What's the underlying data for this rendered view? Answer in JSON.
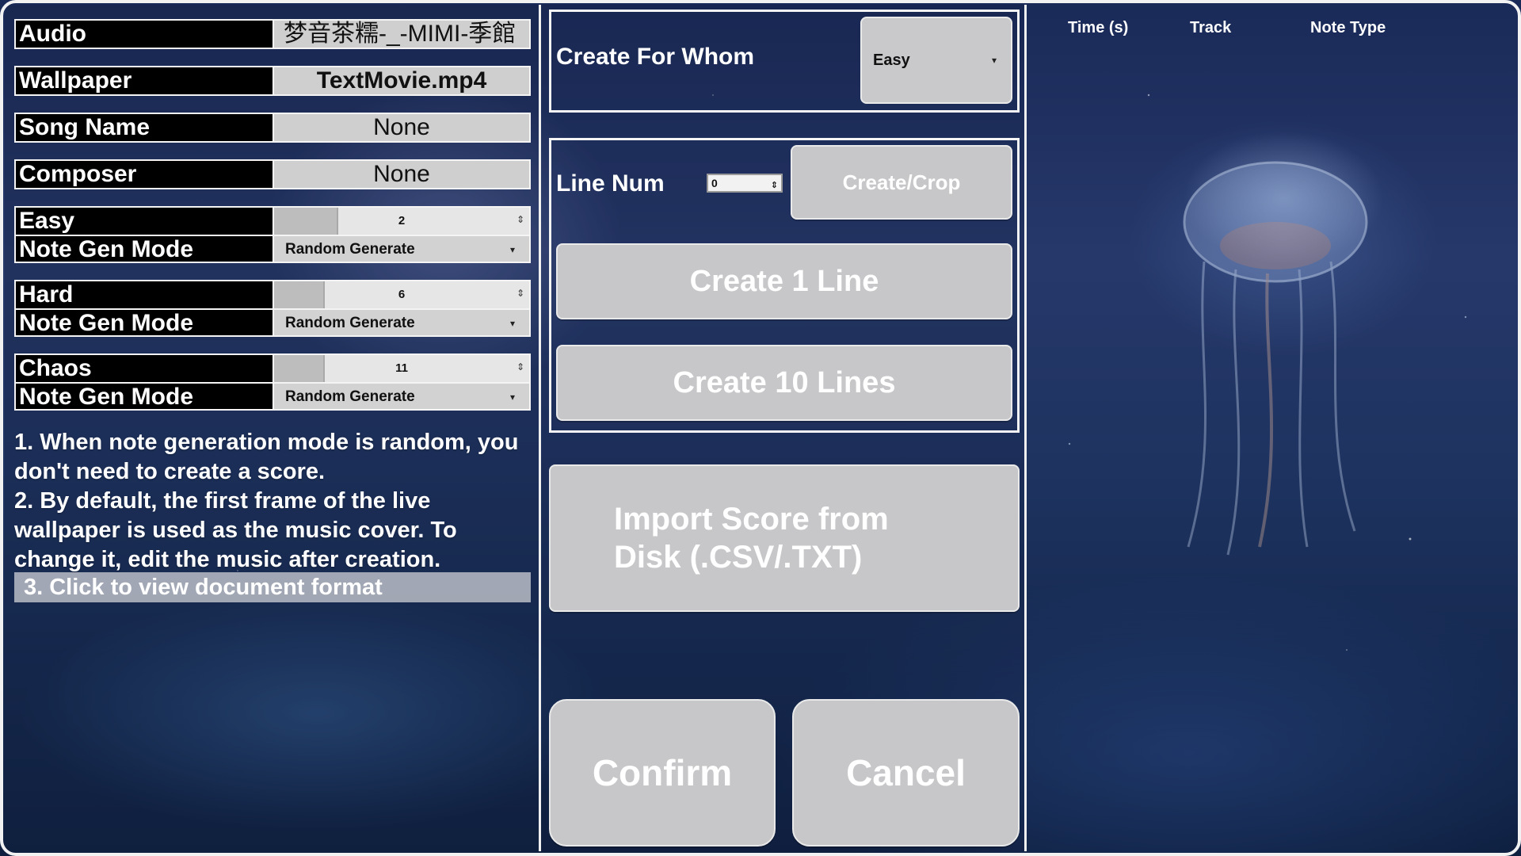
{
  "left": {
    "audio": {
      "label": "Audio",
      "value": "梦音茶糯-_-MIMI-季館"
    },
    "wallpaper": {
      "label": "Wallpaper",
      "value": "TextMovie.mp4"
    },
    "song_name": {
      "label": "Song Name",
      "value": "None"
    },
    "composer": {
      "label": "Composer",
      "value": "None"
    },
    "difficulties": [
      {
        "label": "Easy",
        "level": "2",
        "mode_label": "Note Gen Mode",
        "mode": "Random Generate"
      },
      {
        "label": "Hard",
        "level": "6",
        "mode_label": "Note Gen Mode",
        "mode": "Random Generate"
      },
      {
        "label": "Chaos",
        "level": "11",
        "mode_label": "Note Gen Mode",
        "mode": "Random Generate"
      }
    ],
    "notes": [
      "1. When note generation mode is random, you don't need to create a score.",
      "2. By default, the first frame of the live wallpaper is used as the music cover. To change it, edit the music after creation."
    ],
    "doc_link": "3. Click to view document format"
  },
  "middle": {
    "create_for_label": "Create For Whom",
    "create_for_value": "Easy",
    "line_num_label": "Line Num",
    "line_num_value": "0",
    "create_crop": "Create/Crop",
    "create_1": "Create 1 Line",
    "create_10": "Create 10 Lines",
    "import": "Import Score from Disk (.CSV/.TXT)",
    "confirm": "Confirm",
    "cancel": "Cancel"
  },
  "right": {
    "columns": [
      "Time (s)",
      "Track",
      "Note Type"
    ]
  },
  "colors": {
    "button_bg": "#c7c7c9",
    "label_bg": "#000000",
    "field_bg": "#cfcfcf"
  }
}
